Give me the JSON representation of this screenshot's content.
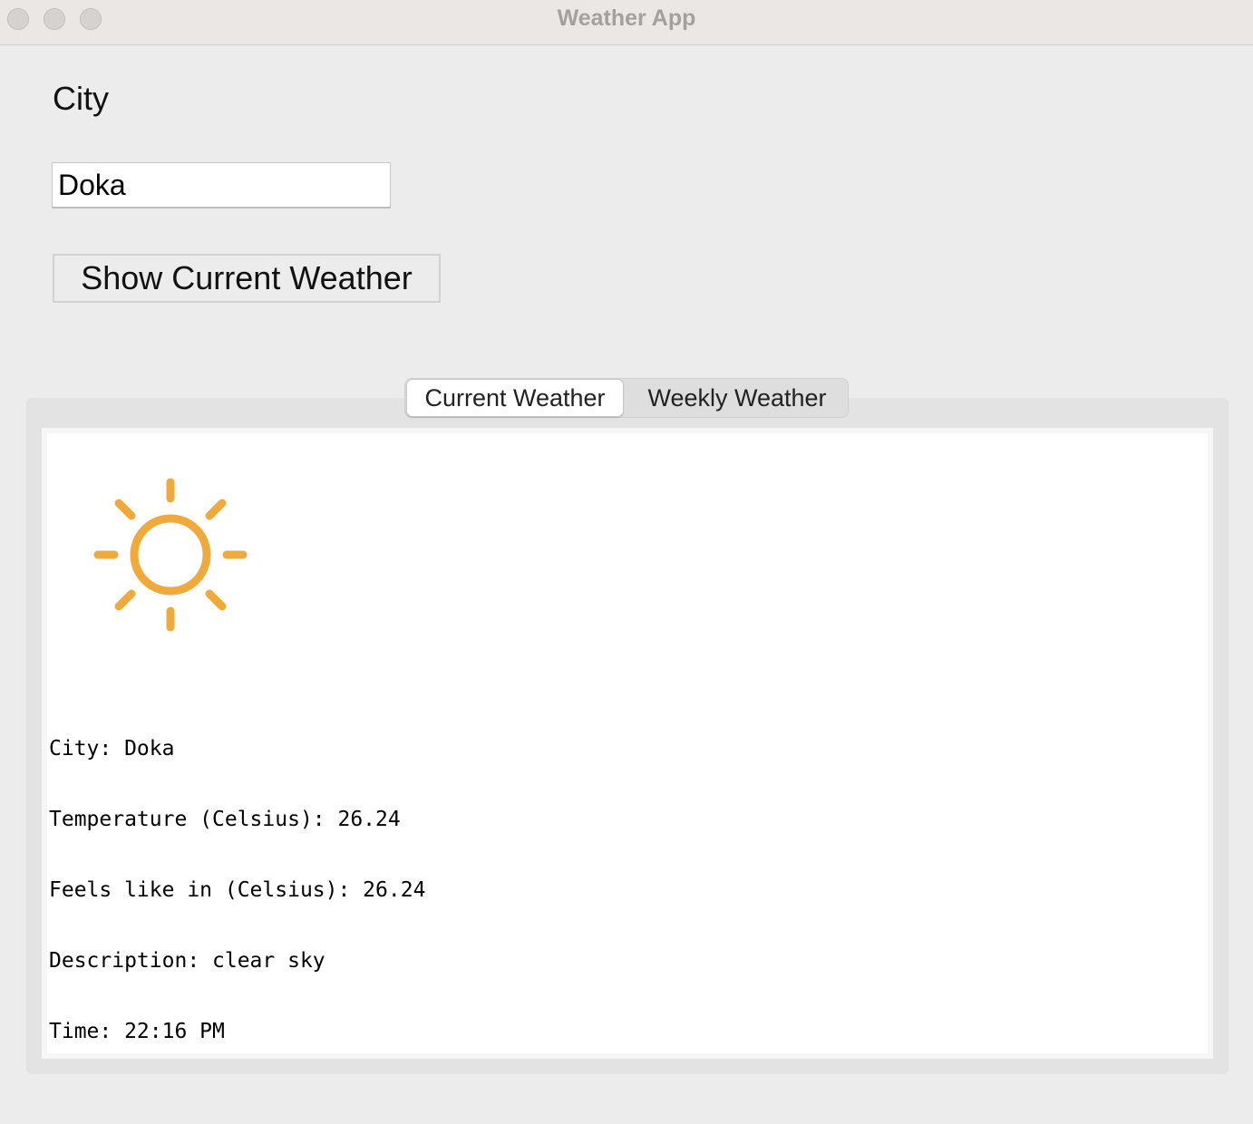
{
  "window": {
    "title": "Weather App"
  },
  "form": {
    "city_label": "City",
    "city_value": "Doka",
    "show_button_label": "Show Current Weather"
  },
  "tabs": [
    {
      "label": "Current Weather",
      "active": true
    },
    {
      "label": "Weekly Weather",
      "active": false
    }
  ],
  "current_weather": {
    "icon": "sun-icon",
    "icon_color": "#F0AA3C",
    "lines": [
      "City: Doka",
      "Temperature (Celsius): 26.24",
      "Feels like in (Celsius): 26.24",
      "Description: clear sky",
      "Time: 22:16 PM"
    ]
  }
}
